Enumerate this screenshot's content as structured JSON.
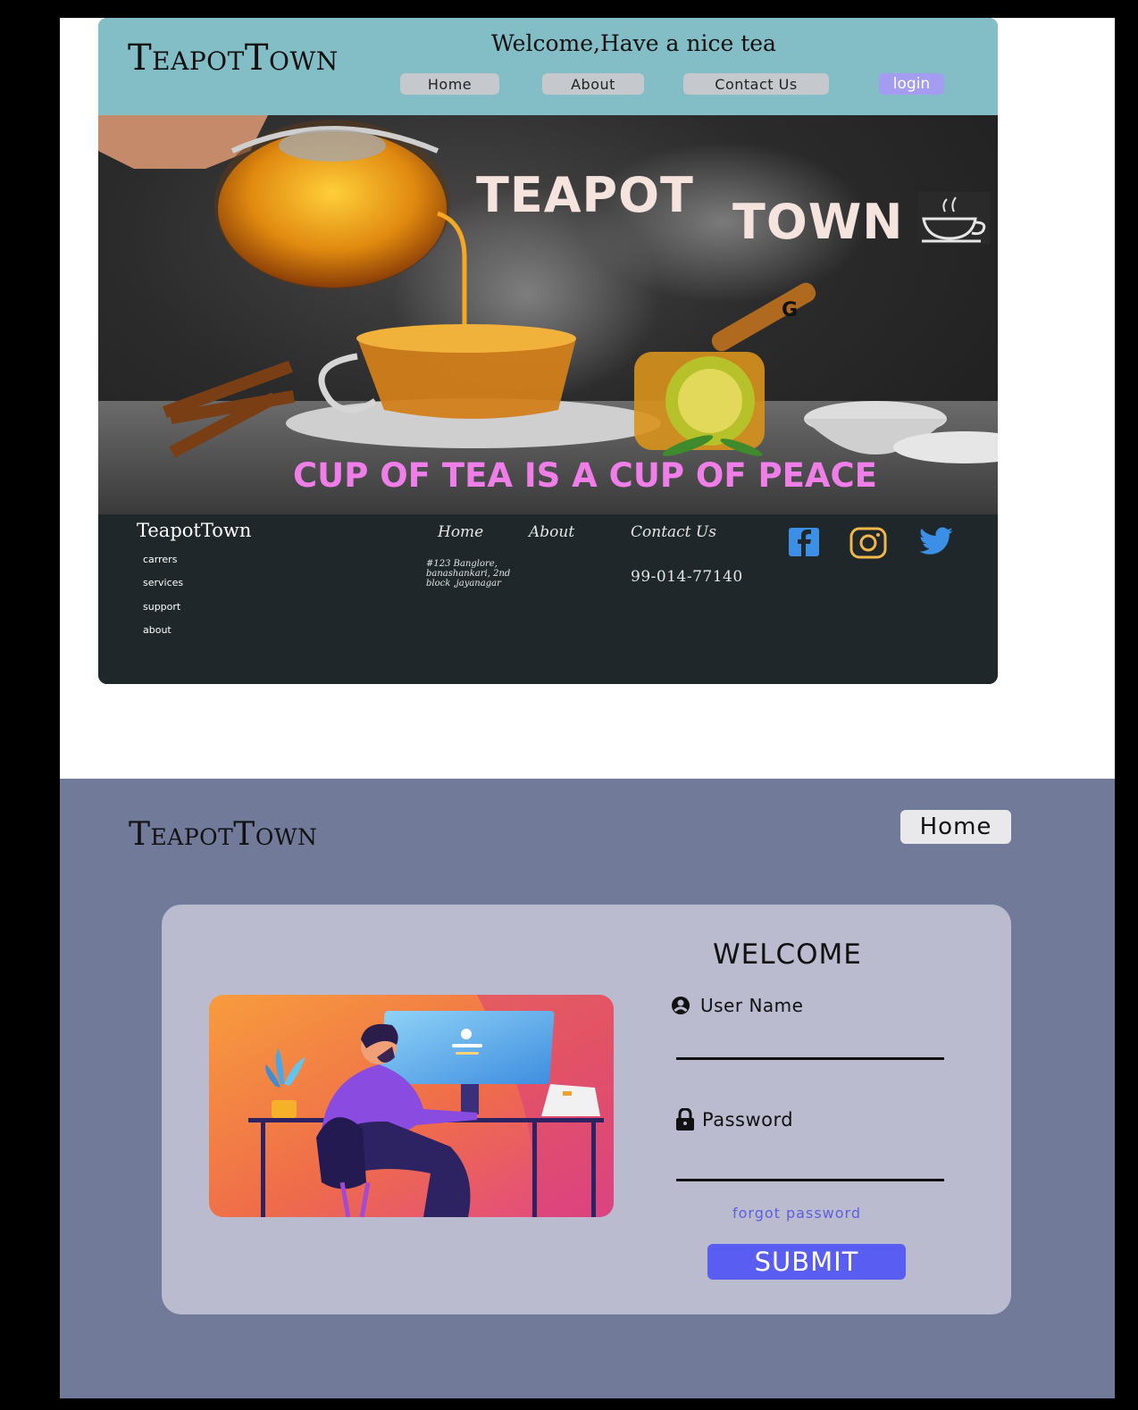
{
  "landing": {
    "logo": "TeapotTown",
    "welcome": "Welcome,Have a nice tea",
    "nav": [
      "Home",
      "About",
      "Contact Us"
    ],
    "login_label": "login",
    "hero": {
      "brand_line1": "TEAPOT",
      "brand_line2": "TOWN",
      "stray_letter": "G",
      "tagline": "CUP OF TEA IS A CUP OF PEACE"
    },
    "footer": {
      "logo": "TeapotTown",
      "links": [
        "carrers",
        "services",
        "support",
        "about"
      ],
      "nav": [
        "Home",
        "About",
        "Contact Us"
      ],
      "address": "#123 Banglore, banashankari, 2nd block ,jayanagar",
      "phone": "99-014-77140",
      "social_icons": [
        "facebook-icon",
        "instagram-icon",
        "twitter-icon"
      ]
    }
  },
  "login_page": {
    "logo": "TeapotTown",
    "home_label": "Home",
    "title": "WELCOME",
    "username_label": "User Name",
    "password_label": "Password",
    "forgot_label": "forgot  password",
    "submit_label": "SUBMIT"
  },
  "colors": {
    "header_teal": "#83bec6",
    "footer_dark": "#1f272b",
    "tagline_pink": "#ef7ee9",
    "login_bg": "#717b99",
    "card_bg": "#babbce",
    "submit_blue": "#5a5df2",
    "social_blue": "#3b8fe6",
    "instagram_gold": "#f2b64a"
  }
}
